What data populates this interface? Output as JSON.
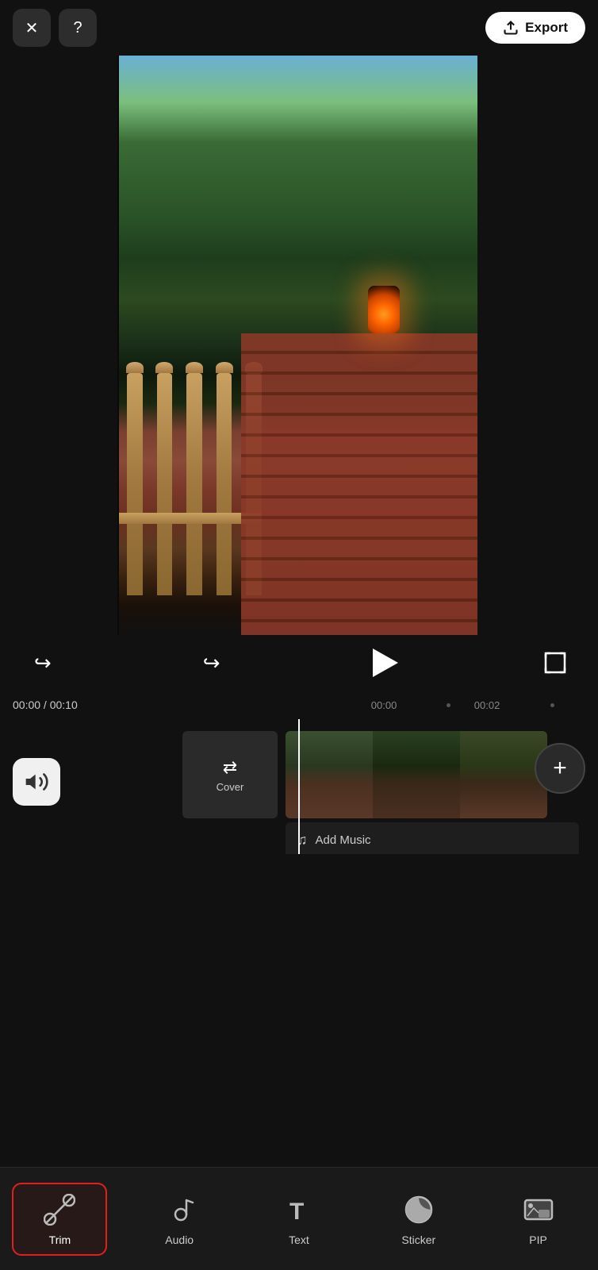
{
  "header": {
    "close_label": "✕",
    "help_label": "?",
    "export_label": "Export"
  },
  "controls": {
    "undo_label": "↩",
    "redo_label": "↪",
    "play_label": "▶",
    "fullscreen_label": "⛶"
  },
  "time": {
    "current": "00:00",
    "total": "00:10",
    "marker1": "00:00",
    "marker2": "00:02"
  },
  "timeline": {
    "cover_label": "Cover",
    "add_music_label": "Add Music",
    "add_clip_label": "+"
  },
  "toolbar": {
    "items": [
      {
        "id": "trim",
        "label": "Trim",
        "active": true
      },
      {
        "id": "audio",
        "label": "Audio",
        "active": false
      },
      {
        "id": "text",
        "label": "Text",
        "active": false
      },
      {
        "id": "sticker",
        "label": "Sticker",
        "active": false
      },
      {
        "id": "pip",
        "label": "PIP",
        "active": false
      }
    ]
  }
}
